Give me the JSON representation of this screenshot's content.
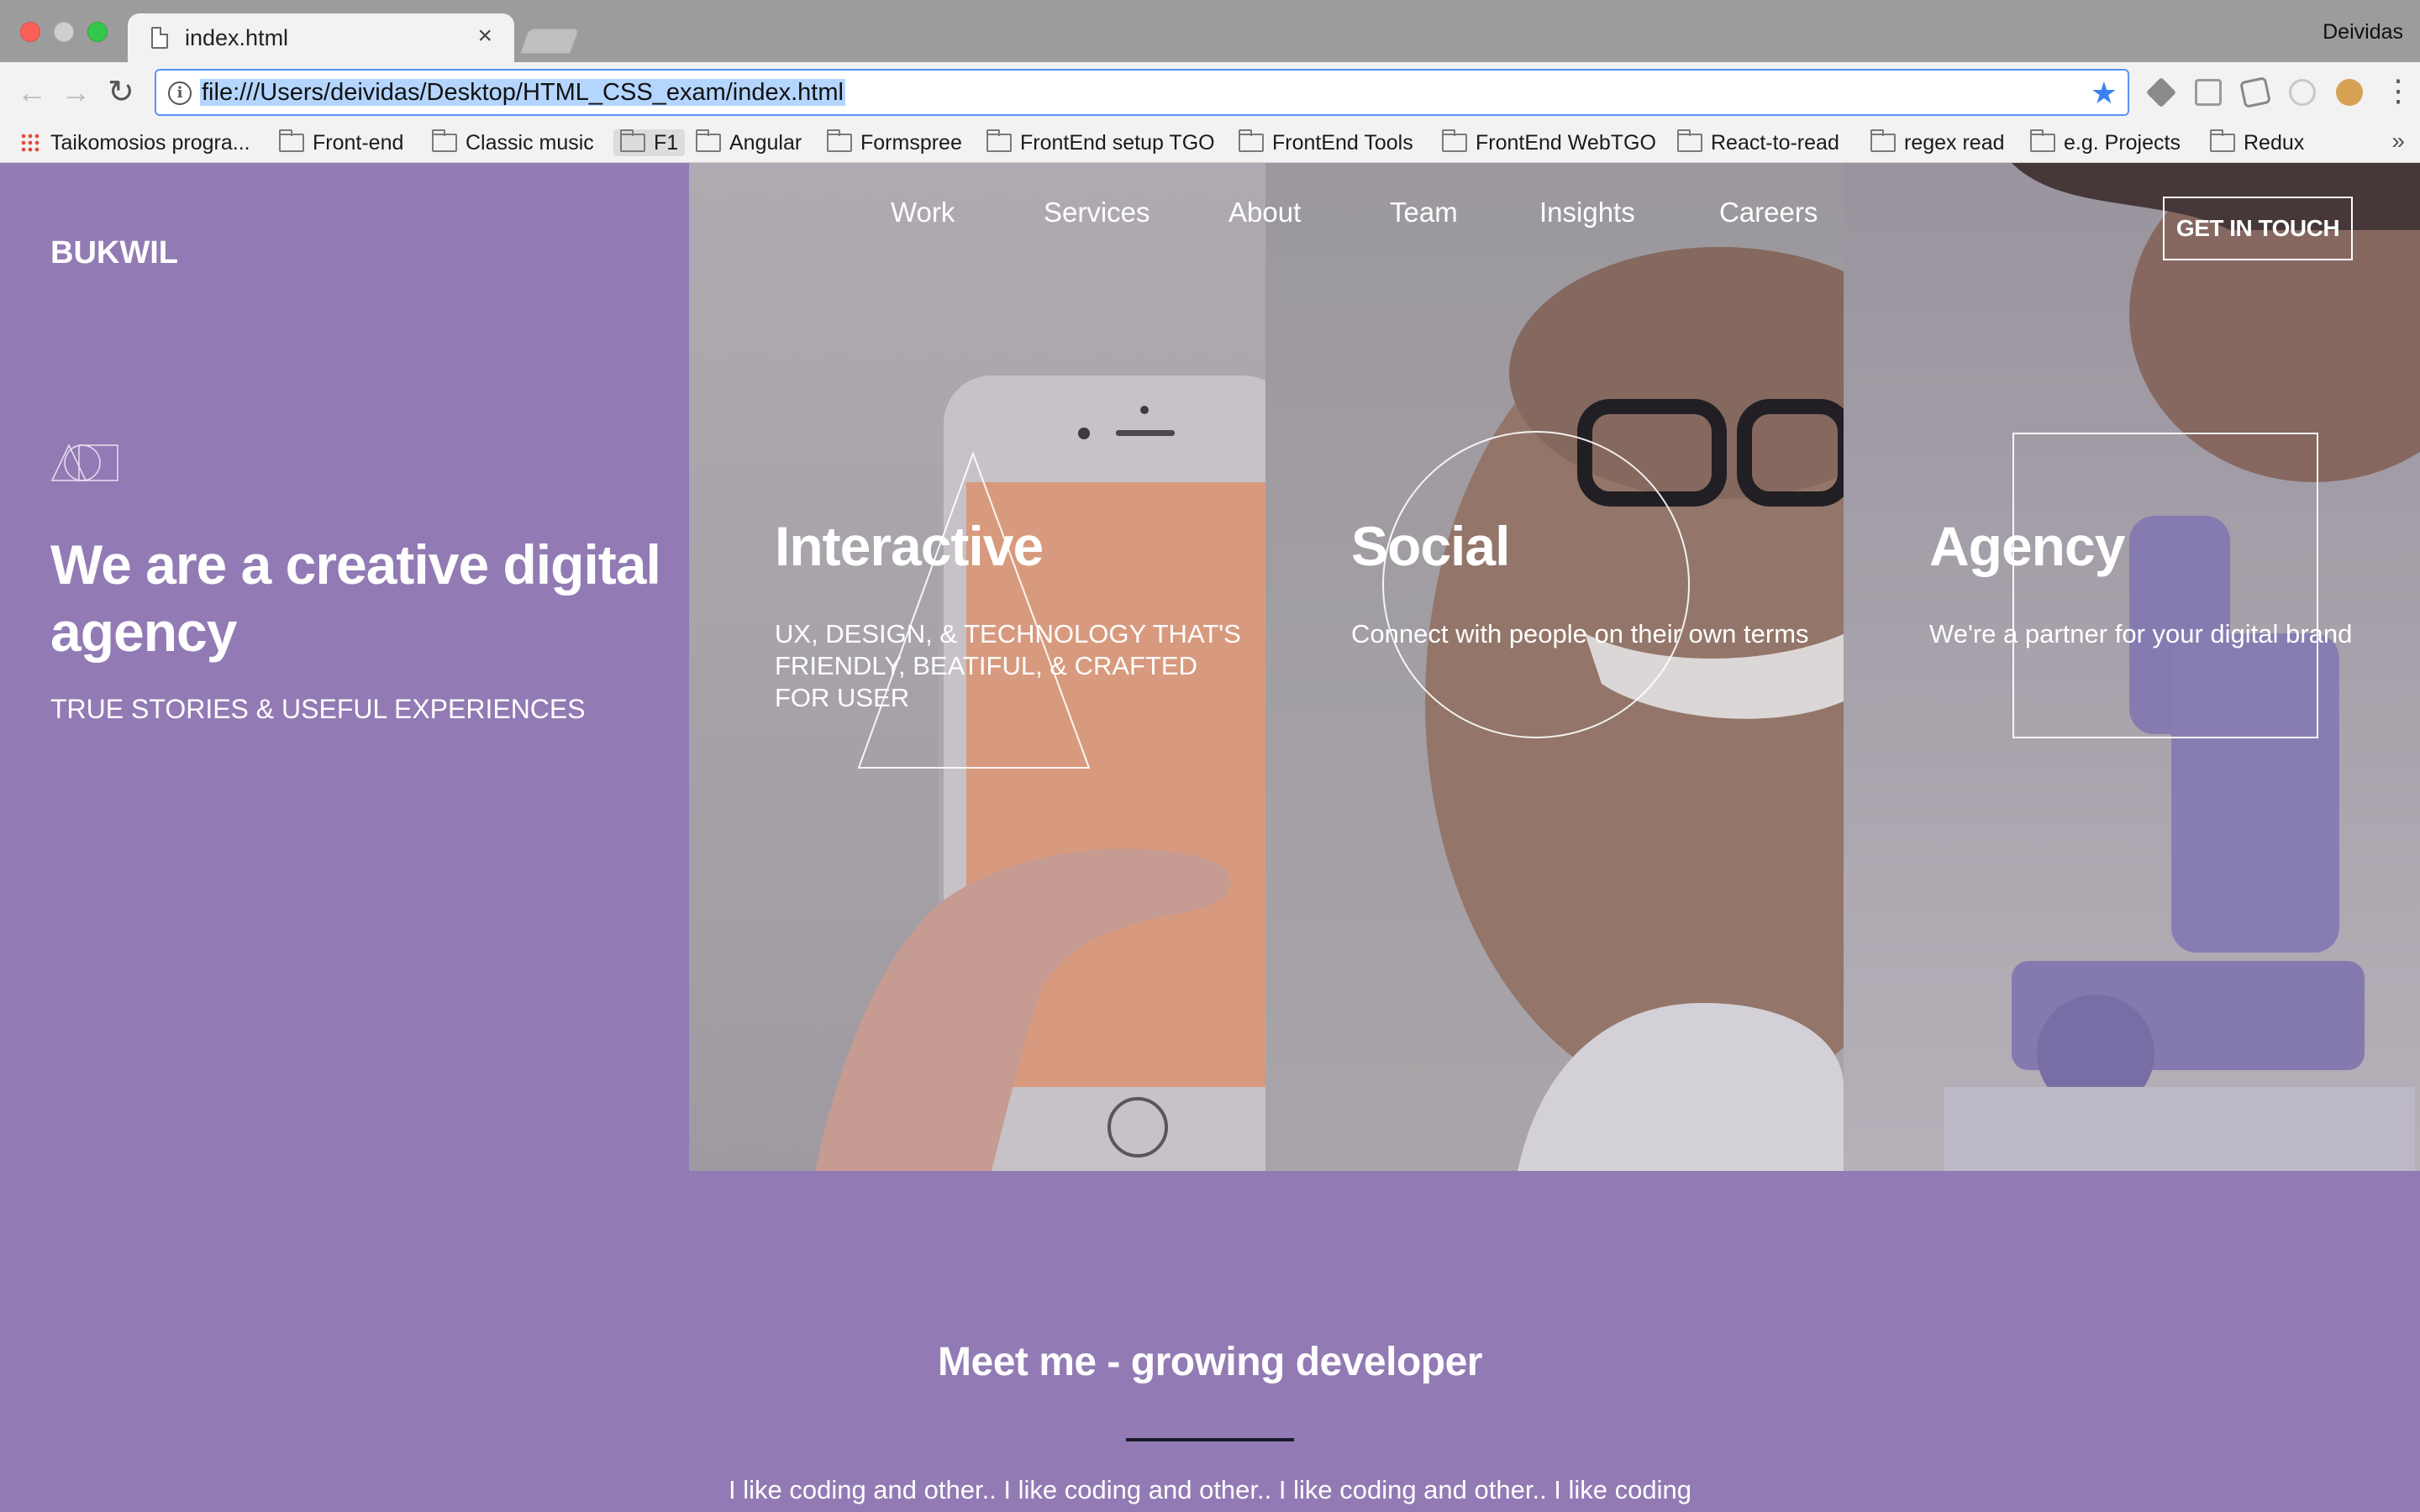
{
  "browser": {
    "tab_title": "index.html",
    "tab_close": "×",
    "profile_name": "Deividas",
    "url": "file:///Users/deividas/Desktop/HTML_CSS_exam/index.html",
    "back": "←",
    "forward": "→",
    "reload": "↻",
    "info": "i",
    "star": "★",
    "menu": "⋮",
    "bookmarks": [
      {
        "label": "Taikomosios progra...",
        "icon": "apps-icon"
      },
      {
        "label": "Front-end",
        "icon": "folder-icon"
      },
      {
        "label": "Classic music",
        "icon": "folder-icon"
      },
      {
        "label": "F1",
        "icon": "folder-icon"
      },
      {
        "label": "Angular",
        "icon": "folder-icon"
      },
      {
        "label": "Formspree",
        "icon": "folder-icon"
      },
      {
        "label": "FrontEnd setup TGO",
        "icon": "folder-icon"
      },
      {
        "label": "FrontEnd Tools",
        "icon": "folder-icon"
      },
      {
        "label": "FrontEnd WebTGO",
        "icon": "folder-icon"
      },
      {
        "label": "React-to-read",
        "icon": "folder-icon"
      },
      {
        "label": "regex read",
        "icon": "folder-icon"
      },
      {
        "label": "e.g. Projects",
        "icon": "folder-icon"
      },
      {
        "label": "Redux",
        "icon": "folder-icon"
      }
    ],
    "bookmarks_more": "»"
  },
  "site": {
    "logo": "BUKWIL",
    "nav": [
      "Work",
      "Services",
      "About",
      "Team",
      "Insights",
      "Careers"
    ],
    "cta": "GET IN TOUCH",
    "hero": {
      "title": "We are a creative digital agency",
      "subtitle": "TRUE STORIES & USEFUL EXPERIENCES"
    },
    "panels": [
      {
        "title": "Interactive",
        "text": "UX, DESIGN, & TECHNOLOGY THAT'S FRIENDLY, BEATIFUL, & CRAFTED FOR USER",
        "shape": "triangle"
      },
      {
        "title": "Social",
        "text": "Connect with people on their own terms",
        "shape": "circle"
      },
      {
        "title": "Agency",
        "text": "We're a partner for your digital brand",
        "shape": "square"
      }
    ],
    "meet": {
      "title": "Meet me - growing developer",
      "text": "I like coding and other.. I like coding and other.. I like coding and other.. I like coding"
    }
  },
  "colors": {
    "page_bg": "#927bb4",
    "accent_blue": "#3b82f0"
  }
}
